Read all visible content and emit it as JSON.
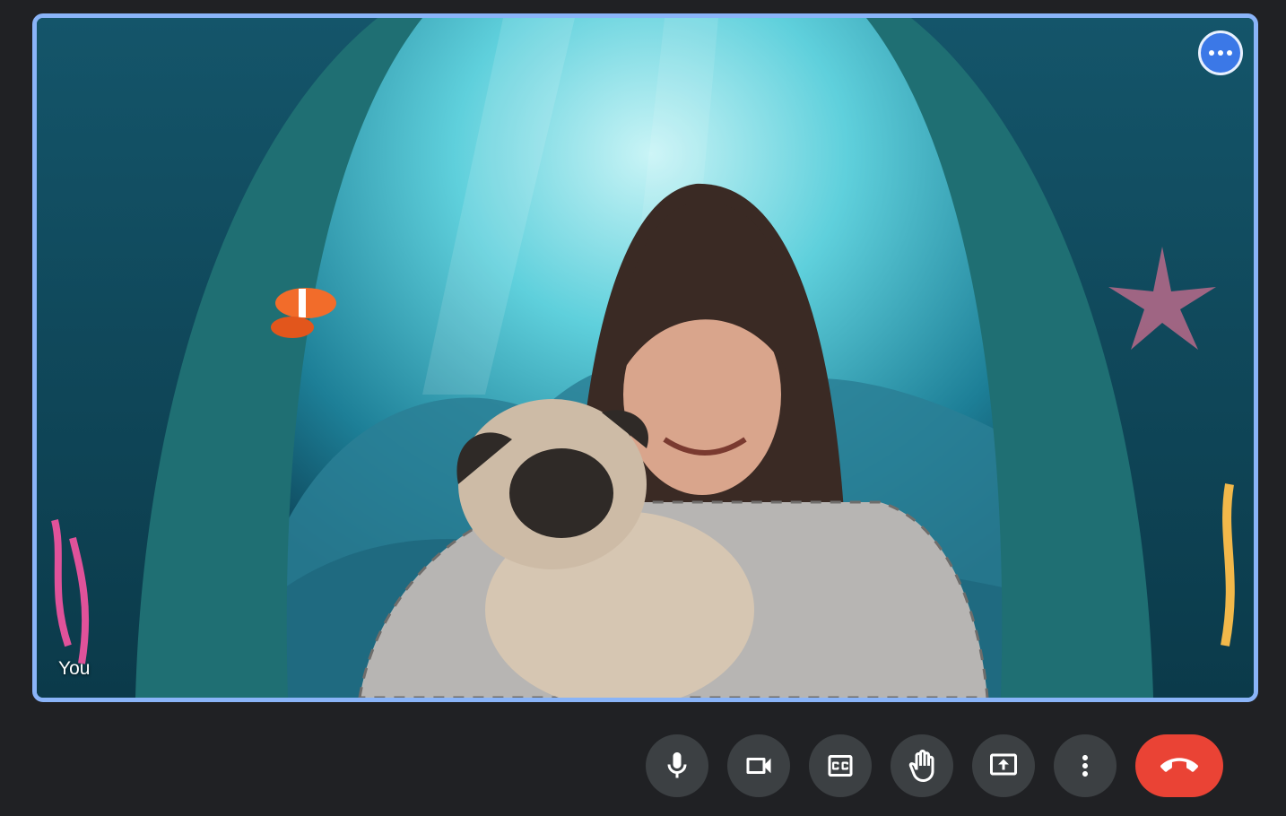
{
  "participant": {
    "name_label": "You",
    "tile_border_color": "#8ab4f8",
    "background_effect": "underwater-scene"
  },
  "tile_actions": {
    "more_options_icon": "more-horiz-icon"
  },
  "controls": [
    {
      "name": "microphone",
      "icon": "microphone-icon"
    },
    {
      "name": "camera",
      "icon": "videocam-icon"
    },
    {
      "name": "captions",
      "icon": "closed-caption-icon"
    },
    {
      "name": "raise-hand",
      "icon": "hand-icon"
    },
    {
      "name": "present",
      "icon": "present-screen-icon"
    },
    {
      "name": "more-options",
      "icon": "more-vert-icon"
    },
    {
      "name": "leave-call",
      "icon": "call-end-icon",
      "color": "#ea4335"
    }
  ]
}
